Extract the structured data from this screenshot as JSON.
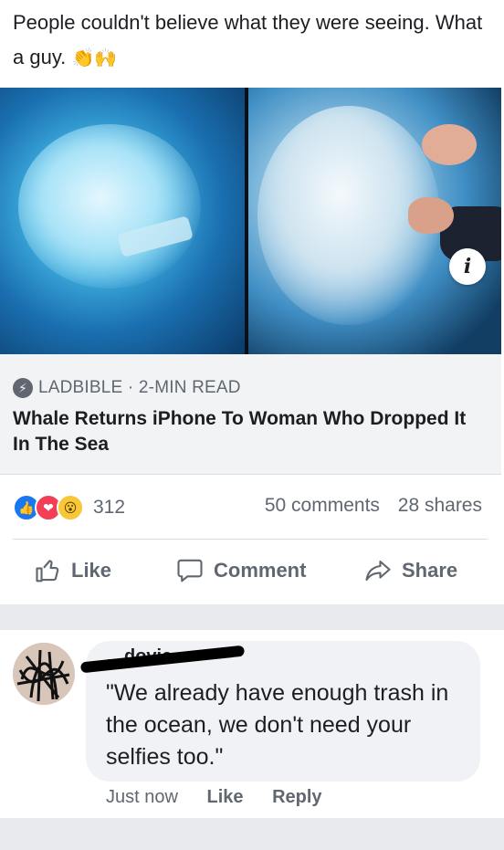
{
  "post": {
    "text": "People couldn't believe what they were seeing. What a guy.",
    "emoji": "👏🙌"
  },
  "link": {
    "source": "LADBIBLE · 2-MIN READ",
    "headline": "Whale Returns iPhone To Woman Who Dropped It In The Sea",
    "info_icon": "i"
  },
  "reactions": {
    "icons": [
      "like-icon",
      "love-icon",
      "wow-icon"
    ],
    "count": "312",
    "comments": "50 comments",
    "shares": "28 shares"
  },
  "actions": {
    "like": "Like",
    "comment": "Comment",
    "share": "Share"
  },
  "comment": {
    "author": "…dovic",
    "text": "\"We already have enough trash in the ocean, we don't need your selfies too.\"",
    "time": "Just now",
    "like": "Like",
    "reply": "Reply"
  },
  "colors": {
    "facebook_blue": "#1877f2",
    "love_red": "#f33e58",
    "wow_yellow": "#f7c738",
    "meta_gray": "#606770"
  }
}
